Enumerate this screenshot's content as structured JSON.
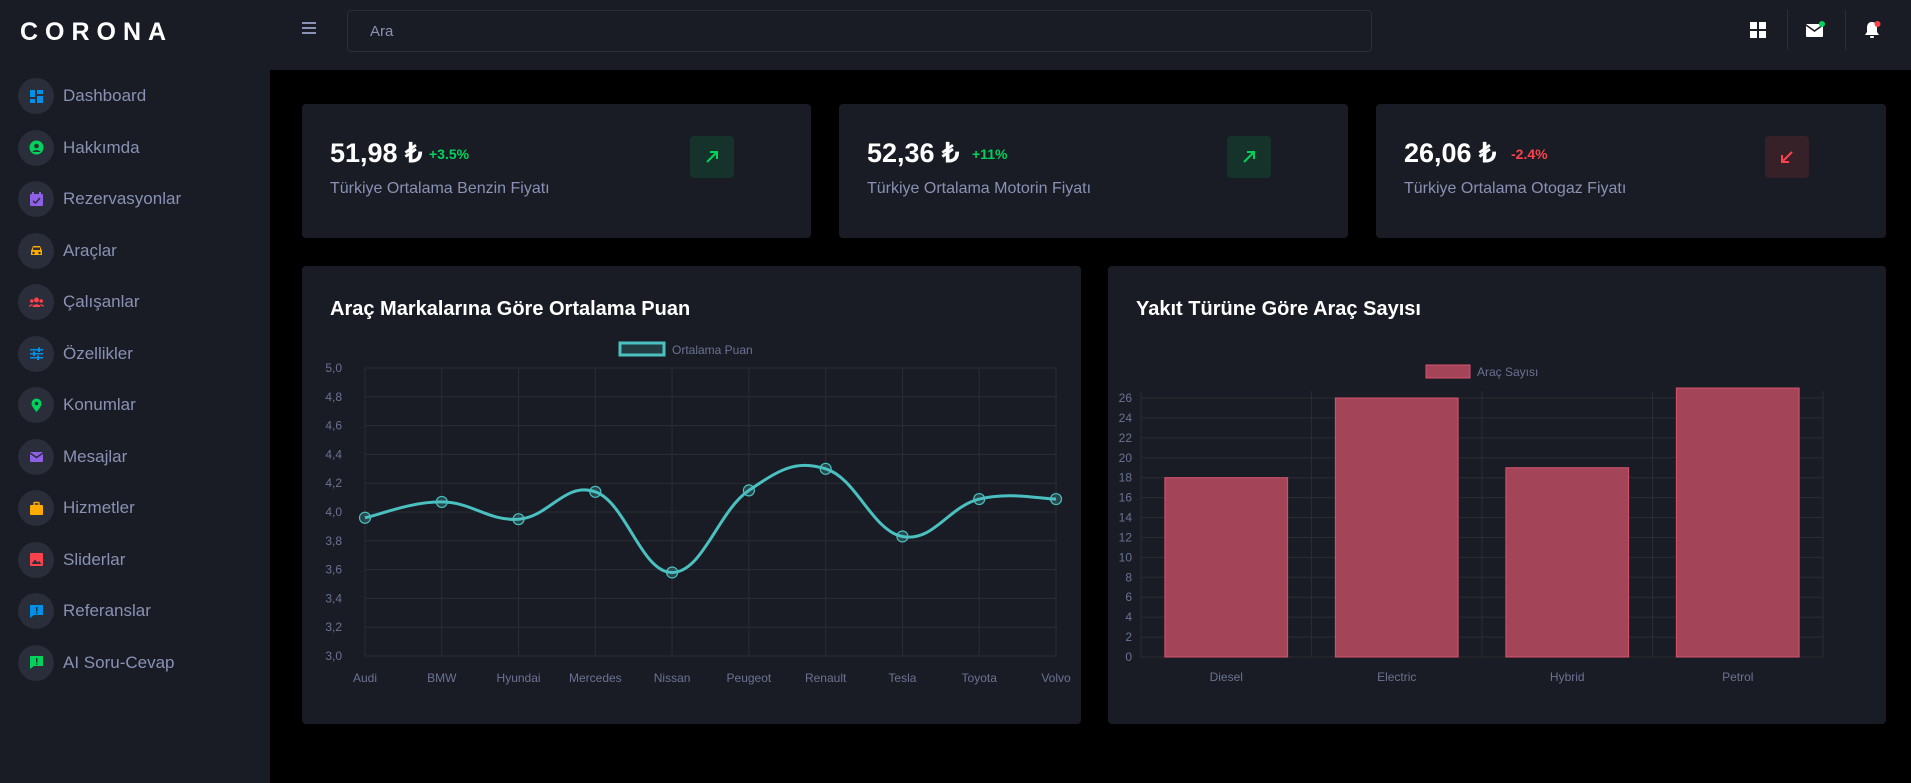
{
  "brand": "CORONA",
  "search": {
    "placeholder": "Ara"
  },
  "sidebar": {
    "items": [
      {
        "label": "Dashboard",
        "icon": "dashboard-icon",
        "color": "#0090e7"
      },
      {
        "label": "Hakkımda",
        "icon": "user-circle-icon",
        "color": "#00d25b"
      },
      {
        "label": "Rezervasyonlar",
        "icon": "calendar-icon",
        "color": "#8f5fe8"
      },
      {
        "label": "Araçlar",
        "icon": "car-icon",
        "color": "#ffab00"
      },
      {
        "label": "Çalışanlar",
        "icon": "people-icon",
        "color": "#fc424a"
      },
      {
        "label": "Özellikler",
        "icon": "sliders-icon",
        "color": "#0090e7"
      },
      {
        "label": "Konumlar",
        "icon": "map-pin-icon",
        "color": "#00d25b"
      },
      {
        "label": "Mesajlar",
        "icon": "mail-icon",
        "color": "#8f5fe8"
      },
      {
        "label": "Hizmetler",
        "icon": "briefcase-icon",
        "color": "#ffab00"
      },
      {
        "label": "Sliderlar",
        "icon": "image-icon",
        "color": "#fc424a"
      },
      {
        "label": "Referanslar",
        "icon": "comment-alert-icon",
        "color": "#0090e7"
      },
      {
        "label": "AI Soru-Cevap",
        "icon": "comment-alert-icon",
        "color": "#00d25b"
      }
    ]
  },
  "stats": [
    {
      "value": "51,98 ₺",
      "change": "+3.5%",
      "label": "Türkiye Ortalama Benzin Fiyatı",
      "trend": "up",
      "color": "#00d25b"
    },
    {
      "value": "52,36 ₺",
      "change": "+11%",
      "label": "Türkiye Ortalama Motorin Fiyatı",
      "trend": "up",
      "color": "#00d25b"
    },
    {
      "value": "26,06 ₺",
      "change": "-2.4%",
      "label": "Türkiye Ortalama Otogaz Fiyatı",
      "trend": "down",
      "color": "#fc424a"
    }
  ],
  "charts": {
    "line_title": "Araç Markalarına Göre Ortalama Puan",
    "bar_title": "Yakıt Türüne Göre Araç Sayısı"
  },
  "chart_data": [
    {
      "type": "line",
      "title": "Araç Markalarına Göre Ortalama Puan",
      "categories": [
        "Audi",
        "BMW",
        "Hyundai",
        "Mercedes",
        "Nissan",
        "Peugeot",
        "Renault",
        "Tesla",
        "Toyota",
        "Volvo"
      ],
      "series": [
        {
          "name": "Ortalama Puan",
          "values": [
            3.96,
            4.07,
            3.95,
            4.14,
            3.58,
            4.15,
            4.3,
            3.83,
            4.09,
            4.09
          ]
        }
      ],
      "ylim": [
        3.0,
        5.0
      ],
      "yticks": [
        "3,0",
        "3,2",
        "3,4",
        "3,6",
        "3,8",
        "4,0",
        "4,2",
        "4,4",
        "4,6",
        "4,8",
        "5,0"
      ],
      "color": "#4bc0c0",
      "legend": "top",
      "grid": true
    },
    {
      "type": "bar",
      "title": "Yakıt Türüne Göre Araç Sayısı",
      "categories": [
        "Diesel",
        "Electric",
        "Hybrid",
        "Petrol"
      ],
      "series": [
        {
          "name": "Araç Sayısı",
          "values": [
            18,
            26,
            19,
            27
          ]
        }
      ],
      "ylim": [
        0,
        27
      ],
      "yticks": [
        "0",
        "2",
        "4",
        "6",
        "8",
        "10",
        "12",
        "14",
        "16",
        "18",
        "20",
        "22",
        "24",
        "26"
      ],
      "color": "#a44459",
      "legend": "top",
      "grid": true
    }
  ]
}
